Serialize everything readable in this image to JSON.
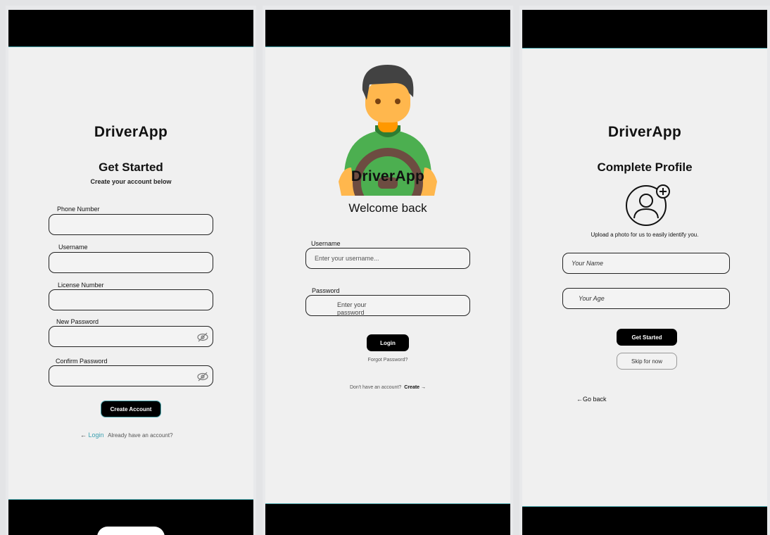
{
  "signup": {
    "brand": "DriverApp",
    "title": "Get Started",
    "subtitle": "Create your account below",
    "fields": {
      "phone_label": "Phone Number",
      "username_label": "Username",
      "license_label": "License Number",
      "new_password_label": "New Password",
      "confirm_password_label": "Confirm Password"
    },
    "create_button": "Create Account",
    "login_arrow": "←",
    "login_link": "Login",
    "login_hint": "Already have an account?"
  },
  "login": {
    "brand": "DriverApp",
    "title": "Welcome back",
    "username_label": "Username",
    "username_placeholder": "Enter your username...",
    "password_label": "Password",
    "password_placeholder": "Enter your password",
    "login_button": "Login",
    "forgot": "Forgot Password?",
    "no_account": "Don't have an account?",
    "create_link": "Create",
    "create_arrow": "→"
  },
  "profile": {
    "brand": "DriverApp",
    "title": "Complete Profile",
    "upload_text": "Upload a photo for us to easily identify you.",
    "name_placeholder": "Your Name",
    "age_placeholder": "Your Age",
    "get_started_button": "Get Started",
    "skip_button": "Skip for now",
    "go_back": "←Go back"
  },
  "colors": {
    "accent": "#4aa7ad",
    "bar": "#000000",
    "screen_bg": "#f0f0f0",
    "link": "#3a9fb0",
    "avatar_shirt": "#4caf50",
    "avatar_skin": "#ffb74d",
    "avatar_hair": "#424242",
    "avatar_wheel": "#6d4c41"
  },
  "icons": [
    "eye-off-icon",
    "driver-avatar",
    "profile-photo-icon",
    "plus-icon"
  ]
}
